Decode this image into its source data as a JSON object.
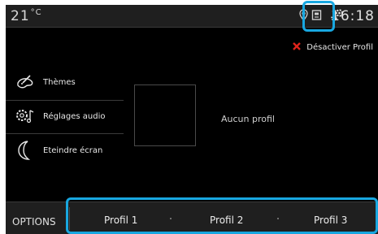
{
  "status_bar": {
    "temperature": "21",
    "temperature_unit": "°C",
    "time": "16:18",
    "icons": [
      "location-pin-icon",
      "phone-icon",
      "settings-gears-icon"
    ]
  },
  "header_action": {
    "icon": "close-x-icon",
    "label": "Désactiver Profil",
    "color": "#e0241b"
  },
  "sidebar": {
    "items": [
      {
        "icon": "palette-icon",
        "label": "Thèmes"
      },
      {
        "icon": "speaker-settings-icon",
        "label": "Réglages audio"
      },
      {
        "icon": "moon-icon",
        "label": "Eteindre écran"
      }
    ]
  },
  "main": {
    "empty_text": "Aucun profil"
  },
  "bottom_bar": {
    "options_label": "OPTIONS",
    "tabs": [
      "Profil 1",
      "Profil 2",
      "Profil 3"
    ]
  },
  "colors": {
    "background": "#000000",
    "bar_background": "#1f1f1f",
    "highlight": "#18a7e0",
    "text": "#e8e8e8"
  }
}
